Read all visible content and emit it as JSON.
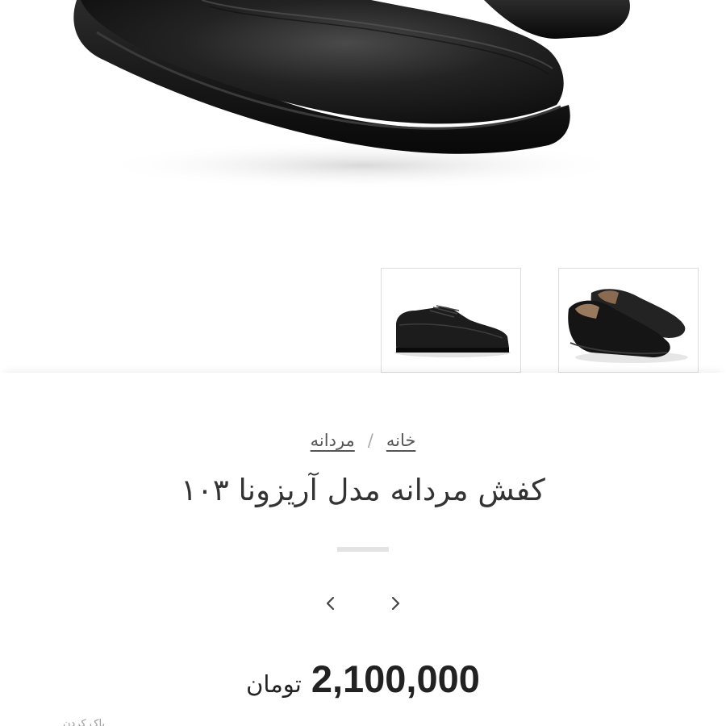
{
  "breadcrumb": {
    "home": "خانه",
    "separator": "/",
    "category": "مردانه"
  },
  "product": {
    "title": "کفش مردانه مدل آریزونا ۱۰۳",
    "price": "2,100,000",
    "currency": "تومان"
  },
  "actions": {
    "clear_label": "پاک کردن"
  },
  "icons": {
    "prev": "chevron-left-icon",
    "next": "chevron-right-icon"
  },
  "colors": {
    "text": "#333333",
    "divider": "#e3e3e3",
    "thumb_border": "#dcdcdc"
  }
}
